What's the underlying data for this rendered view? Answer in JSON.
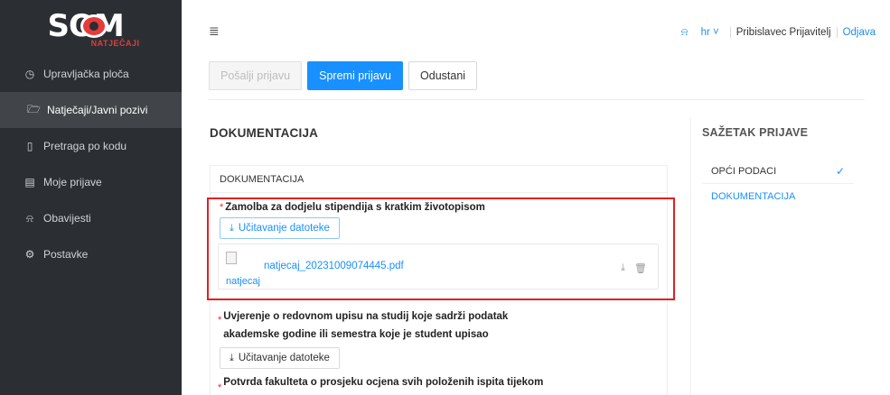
{
  "logo": {
    "brand": "SOM",
    "sub": "NATJEČAJI"
  },
  "sidebar": {
    "items": [
      {
        "label": "Upravljačka ploča",
        "icon": "dashboard-icon",
        "glyph": "◷"
      },
      {
        "label": "Natječaji/Javni pozivi",
        "icon": "folder-open-icon",
        "glyph": "🗁"
      },
      {
        "label": "Pretraga po kodu",
        "icon": "file-search-icon",
        "glyph": "▯"
      },
      {
        "label": "Moje prijave",
        "icon": "file-text-icon",
        "glyph": "▤"
      },
      {
        "label": "Obavijesti",
        "icon": "bell-icon",
        "glyph": "♫"
      },
      {
        "label": "Postavke",
        "icon": "gear-icon",
        "glyph": "⚙"
      }
    ]
  },
  "topbar": {
    "menu_icon": "≣",
    "lang": "hr",
    "user": "Pribislavec Prijavitelj",
    "logout": "Odjava"
  },
  "actions": {
    "send": "Pošalji prijavu",
    "save": "Spremi prijavu",
    "cancel": "Odustani"
  },
  "main": {
    "section_title": "DOKUMENTACIJA",
    "panel_title": "DOKUMENTACIJA",
    "upload_label": "Učitavanje datoteke",
    "fields": [
      {
        "label": "Zamolba za dodjelu stipendija s kratkim životopisom"
      },
      {
        "label_line1": "Uvjerenje o redovnom upisu na studij koje sadrži podatak",
        "label_line2": "akademske godine ili semestra koje je student upisao"
      },
      {
        "label": "Potvrda fakulteta o prosjeku ocjena svih položenih ispita tijekom"
      }
    ],
    "file": {
      "name": "natjecaj_20231009074445.pdf",
      "alt": "natjecaj_20231009074445.pdf"
    }
  },
  "summary": {
    "title": "SAŽETAK PRIJAVE",
    "items": [
      {
        "label": "OPĆI PODACI",
        "status": "done"
      },
      {
        "label": "DOKUMENTACIJA",
        "status": "current"
      }
    ]
  },
  "colors": {
    "accent": "#1890ff",
    "sidebar": "#2b2f33",
    "highlight": "#e02020",
    "required": "#f5222d"
  }
}
